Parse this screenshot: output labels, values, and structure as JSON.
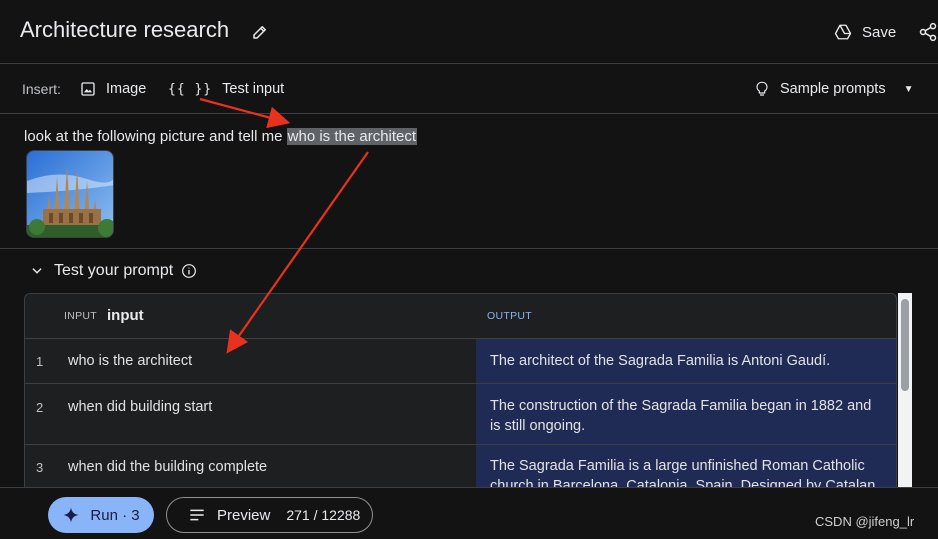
{
  "header": {
    "title": "Architecture research",
    "save_label": "Save"
  },
  "toolbar": {
    "insert_label": "Insert:",
    "image_label": "Image",
    "test_input_braces": "{{ }}",
    "test_input_label": "Test input",
    "sample_prompts_label": "Sample prompts"
  },
  "prompt": {
    "text_before": "look at the following picture and tell me ",
    "text_highlight": "who is the architect"
  },
  "test_section": {
    "title": "Test your prompt"
  },
  "table": {
    "input_tag": "INPUT",
    "input_name": "input",
    "output_tag": "OUTPUT",
    "rows": [
      {
        "num": "1",
        "input": "who is the architect",
        "output": "The architect of the Sagrada Familia is Antoni Gaudí."
      },
      {
        "num": "2",
        "input": "when did building start",
        "output": "The construction of the Sagrada Familia began in 1882 and is still ongoing."
      },
      {
        "num": "3",
        "input": "when did the building complete",
        "output": "The Sagrada Familia is a large unfinished Roman Catholic church in Barcelona, Catalonia, Spain. Designed by Catalan"
      }
    ]
  },
  "footer": {
    "run_label": "Run · 3",
    "preview_label": "Preview",
    "token_count": "271 / 12288",
    "watermark": "CSDN @jifeng_lr"
  },
  "colors": {
    "accent": "#8ab4f8",
    "output_bg": "#1f2b55",
    "annotation_arrow": "#e8321e"
  }
}
